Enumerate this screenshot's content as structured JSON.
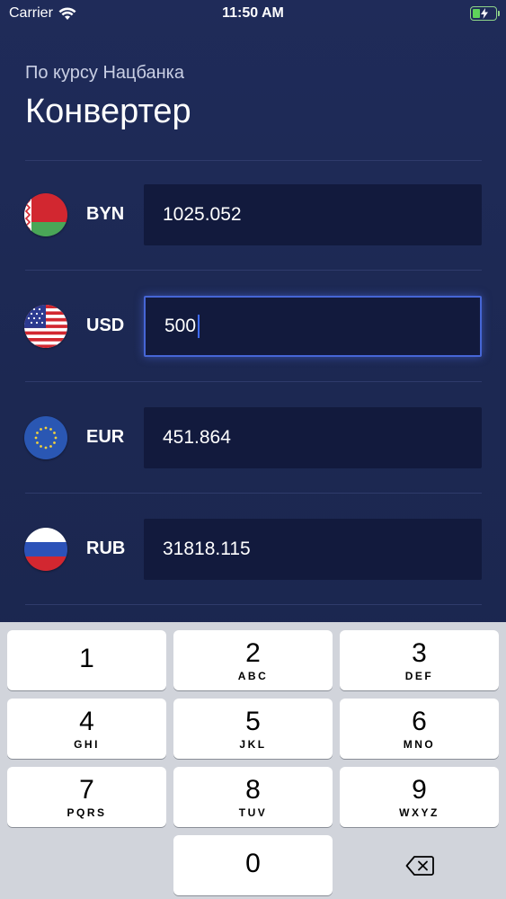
{
  "status_bar": {
    "carrier": "Carrier",
    "time": "11:50 AM"
  },
  "header": {
    "subtitle": "По курсу Нацбанка",
    "title": "Конвертер"
  },
  "currencies": [
    {
      "code": "BYN",
      "value": "1025.052",
      "flag": "belarus-flag-icon"
    },
    {
      "code": "USD",
      "value": "500",
      "flag": "usa-flag-icon"
    },
    {
      "code": "EUR",
      "value": "451.864",
      "flag": "eu-flag-icon"
    },
    {
      "code": "RUB",
      "value": "31818.115",
      "flag": "russia-flag-icon"
    }
  ],
  "keyboard": {
    "keys": [
      {
        "digit": "1",
        "letters": ""
      },
      {
        "digit": "2",
        "letters": "ABC"
      },
      {
        "digit": "3",
        "letters": "DEF"
      },
      {
        "digit": "4",
        "letters": "GHI"
      },
      {
        "digit": "5",
        "letters": "JKL"
      },
      {
        "digit": "6",
        "letters": "MNO"
      },
      {
        "digit": "7",
        "letters": "PQRS"
      },
      {
        "digit": "8",
        "letters": "TUV"
      },
      {
        "digit": "9",
        "letters": "WXYZ"
      },
      {
        "digit": "0",
        "letters": ""
      }
    ],
    "delete_icon": "backspace-icon"
  },
  "colors": {
    "background": "#1f2b59",
    "field": "#121a3d",
    "accent": "#4666d6",
    "keyboard": "#d1d4db"
  }
}
